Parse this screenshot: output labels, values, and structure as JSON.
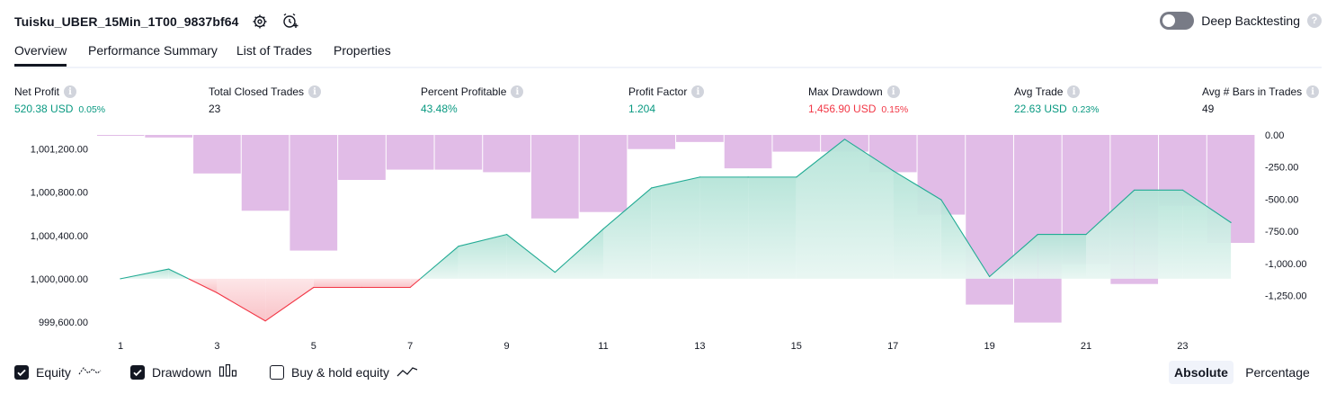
{
  "header": {
    "strategy_name": "Tuisku_UBER_15Min_1T00_9837bf64",
    "deep_backtesting_label": "Deep Backtesting"
  },
  "tabs": [
    "Overview",
    "Performance Summary",
    "List of Trades",
    "Properties"
  ],
  "metrics": [
    {
      "label": "Net Profit",
      "value": "520.38 USD",
      "pct": "0.05%",
      "color": "green"
    },
    {
      "label": "Total Closed Trades",
      "value": "23",
      "pct": "",
      "color": "dark"
    },
    {
      "label": "Percent Profitable",
      "value": "43.48%",
      "pct": "",
      "color": "green"
    },
    {
      "label": "Profit Factor",
      "value": "1.204",
      "pct": "",
      "color": "green"
    },
    {
      "label": "Max Drawdown",
      "value": "1,456.90 USD",
      "pct": "0.15%",
      "color": "red"
    },
    {
      "label": "Avg Trade",
      "value": "22.63 USD",
      "pct": "0.23%",
      "color": "green"
    },
    {
      "label": "Avg # Bars in Trades",
      "value": "49",
      "pct": "",
      "color": "dark"
    }
  ],
  "legend": {
    "equity": "Equity",
    "drawdown": "Drawdown",
    "buy_hold": "Buy & hold equity",
    "equity_checked": true,
    "drawdown_checked": true,
    "buy_hold_checked": false
  },
  "modes": {
    "absolute": "Absolute",
    "percentage": "Percentage",
    "selected": "absolute"
  },
  "colors": {
    "equity_line": "#22ab94",
    "equity_fill": "#c8ebe2",
    "loss_line": "#f23645",
    "loss_fill": "#fcd6d9",
    "drawdown_bar": "#ce93d8"
  },
  "chart_data": {
    "type": "line",
    "x": [
      1,
      2,
      3,
      4,
      5,
      6,
      7,
      8,
      9,
      10,
      11,
      12,
      13,
      14,
      15,
      16,
      17,
      18,
      19,
      20,
      21,
      22,
      23,
      24
    ],
    "x_tick_labels": [
      "1",
      "3",
      "5",
      "7",
      "9",
      "11",
      "13",
      "15",
      "17",
      "19",
      "21",
      "23"
    ],
    "series": [
      {
        "axis": "left",
        "values": [
          1000000,
          1000090,
          999870,
          999610,
          999920,
          999920,
          999920,
          1000300,
          1000410,
          1000060,
          1000460,
          1000840,
          1000940,
          1000940,
          1000940,
          1001290,
          1001000,
          1000730,
          1000020,
          1000410,
          1000410,
          1000820,
          1000820,
          1000520
        ]
      },
      {
        "axis": "right",
        "type": "bar",
        "values": [
          -5,
          -20,
          -300,
          -590,
          -900,
          -350,
          -270,
          -270,
          -290,
          -650,
          -600,
          -110,
          -55,
          -260,
          -130,
          -130,
          -290,
          -620,
          -1320,
          -1460,
          -1005,
          -1160,
          -550,
          -840
        ]
      }
    ],
    "left_axis": {
      "ticks": [
        "1,001,200.00",
        "1,000,800.00",
        "1,000,400.00",
        "1,000,000.00",
        "999,600.00"
      ],
      "ylim": [
        999500,
        1001330
      ],
      "baseline": 1000000
    },
    "right_axis": {
      "ticks": [
        "0.00",
        "-250.00",
        "-500.00",
        "-750.00",
        "-1,000.00",
        "-1,250.00"
      ],
      "ylim": [
        -1540,
        0
      ]
    },
    "legend_placement": "bottom-left"
  }
}
